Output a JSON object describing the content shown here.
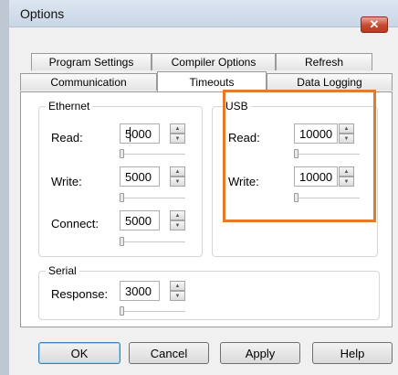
{
  "dialog": {
    "title": "Options",
    "close_glyph": "✕"
  },
  "tabs_row1": [
    "Program Settings",
    "Compiler Options",
    "Refresh"
  ],
  "tabs_row2": [
    "Communication",
    "Timeouts",
    "Data Logging"
  ],
  "active_tab": "Timeouts",
  "ethernet": {
    "label": "Ethernet",
    "fields": [
      {
        "label": "Read:",
        "value": "5000"
      },
      {
        "label": "Write:",
        "value": "5000"
      },
      {
        "label": "Connect:",
        "value": "5000"
      }
    ]
  },
  "usb": {
    "label": "USB",
    "fields": [
      {
        "label": "Read:",
        "value": "10000"
      },
      {
        "label": "Write:",
        "value": "10000"
      }
    ]
  },
  "serial": {
    "label": "Serial",
    "fields": [
      {
        "label": "Response:",
        "value": "3000"
      }
    ]
  },
  "buttons": {
    "ok": "OK",
    "cancel": "Cancel",
    "apply": "Apply",
    "help": "Help"
  },
  "colors": {
    "highlight": "#e37b2a",
    "close_button": "#c6482f"
  },
  "icons": {
    "spin_up": "▲",
    "spin_down": "▼"
  }
}
